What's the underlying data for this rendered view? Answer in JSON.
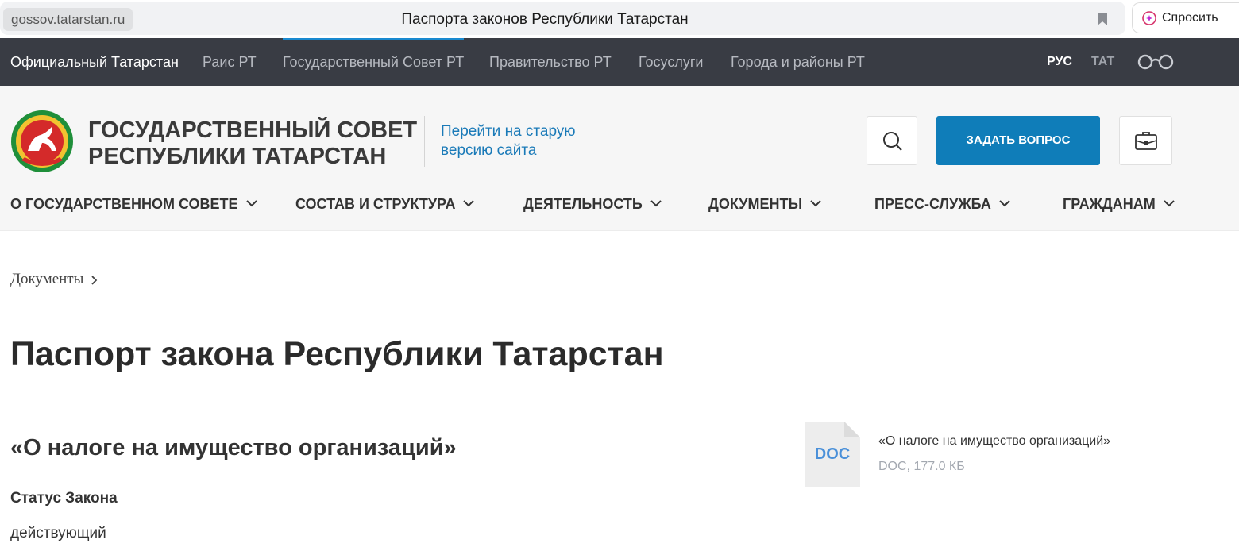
{
  "browser": {
    "domain": "gossov.tatarstan.ru",
    "title": "Паспорта законов Республики Татарстан",
    "ask_label": "Спросить"
  },
  "topnav": {
    "items": [
      "Официальный Татарстан",
      "Раис РТ",
      "Государственный Совет РТ",
      "Правительство РТ",
      "Госуслуги",
      "Города и районы РТ"
    ],
    "current": "Государственный Совет РТ",
    "lang_ru": "РУС",
    "lang_tt": "ТАТ"
  },
  "header": {
    "org_name_line1": "ГОСУДАРСТВЕННЫЙ СОВЕТ",
    "org_name_line2": "РЕСПУБЛИКИ ТАТАРСТАН",
    "old_site_line1": "Перейти на старую",
    "old_site_line2": "версию сайта",
    "ask_question": "ЗАДАТЬ ВОПРОС"
  },
  "mainnav": {
    "items": [
      "О ГОСУДАРСТВЕННОМ СОВЕТЕ",
      "СОСТАВ И СТРУКТУРА",
      "ДЕЯТЕЛЬНОСТЬ",
      "ДОКУМЕНТЫ",
      "ПРЕСС-СЛУЖБА",
      "ГРАЖДАНАМ"
    ]
  },
  "breadcrumb": {
    "item": "Документы"
  },
  "page": {
    "title": "Паспорт закона Республики Татарстан",
    "law_name": "«О налоге на имущество организаций»",
    "status_label": "Статус Закона",
    "status_value": "действующий"
  },
  "attachment": {
    "ext": "DOC",
    "title": "«О налоге на имущество организаций»",
    "meta": "DOC, 177.0 КБ"
  },
  "colors": {
    "topnav_bg": "#393c44",
    "accent_blue": "#0f7db9",
    "link_blue": "#1a7ab8"
  }
}
